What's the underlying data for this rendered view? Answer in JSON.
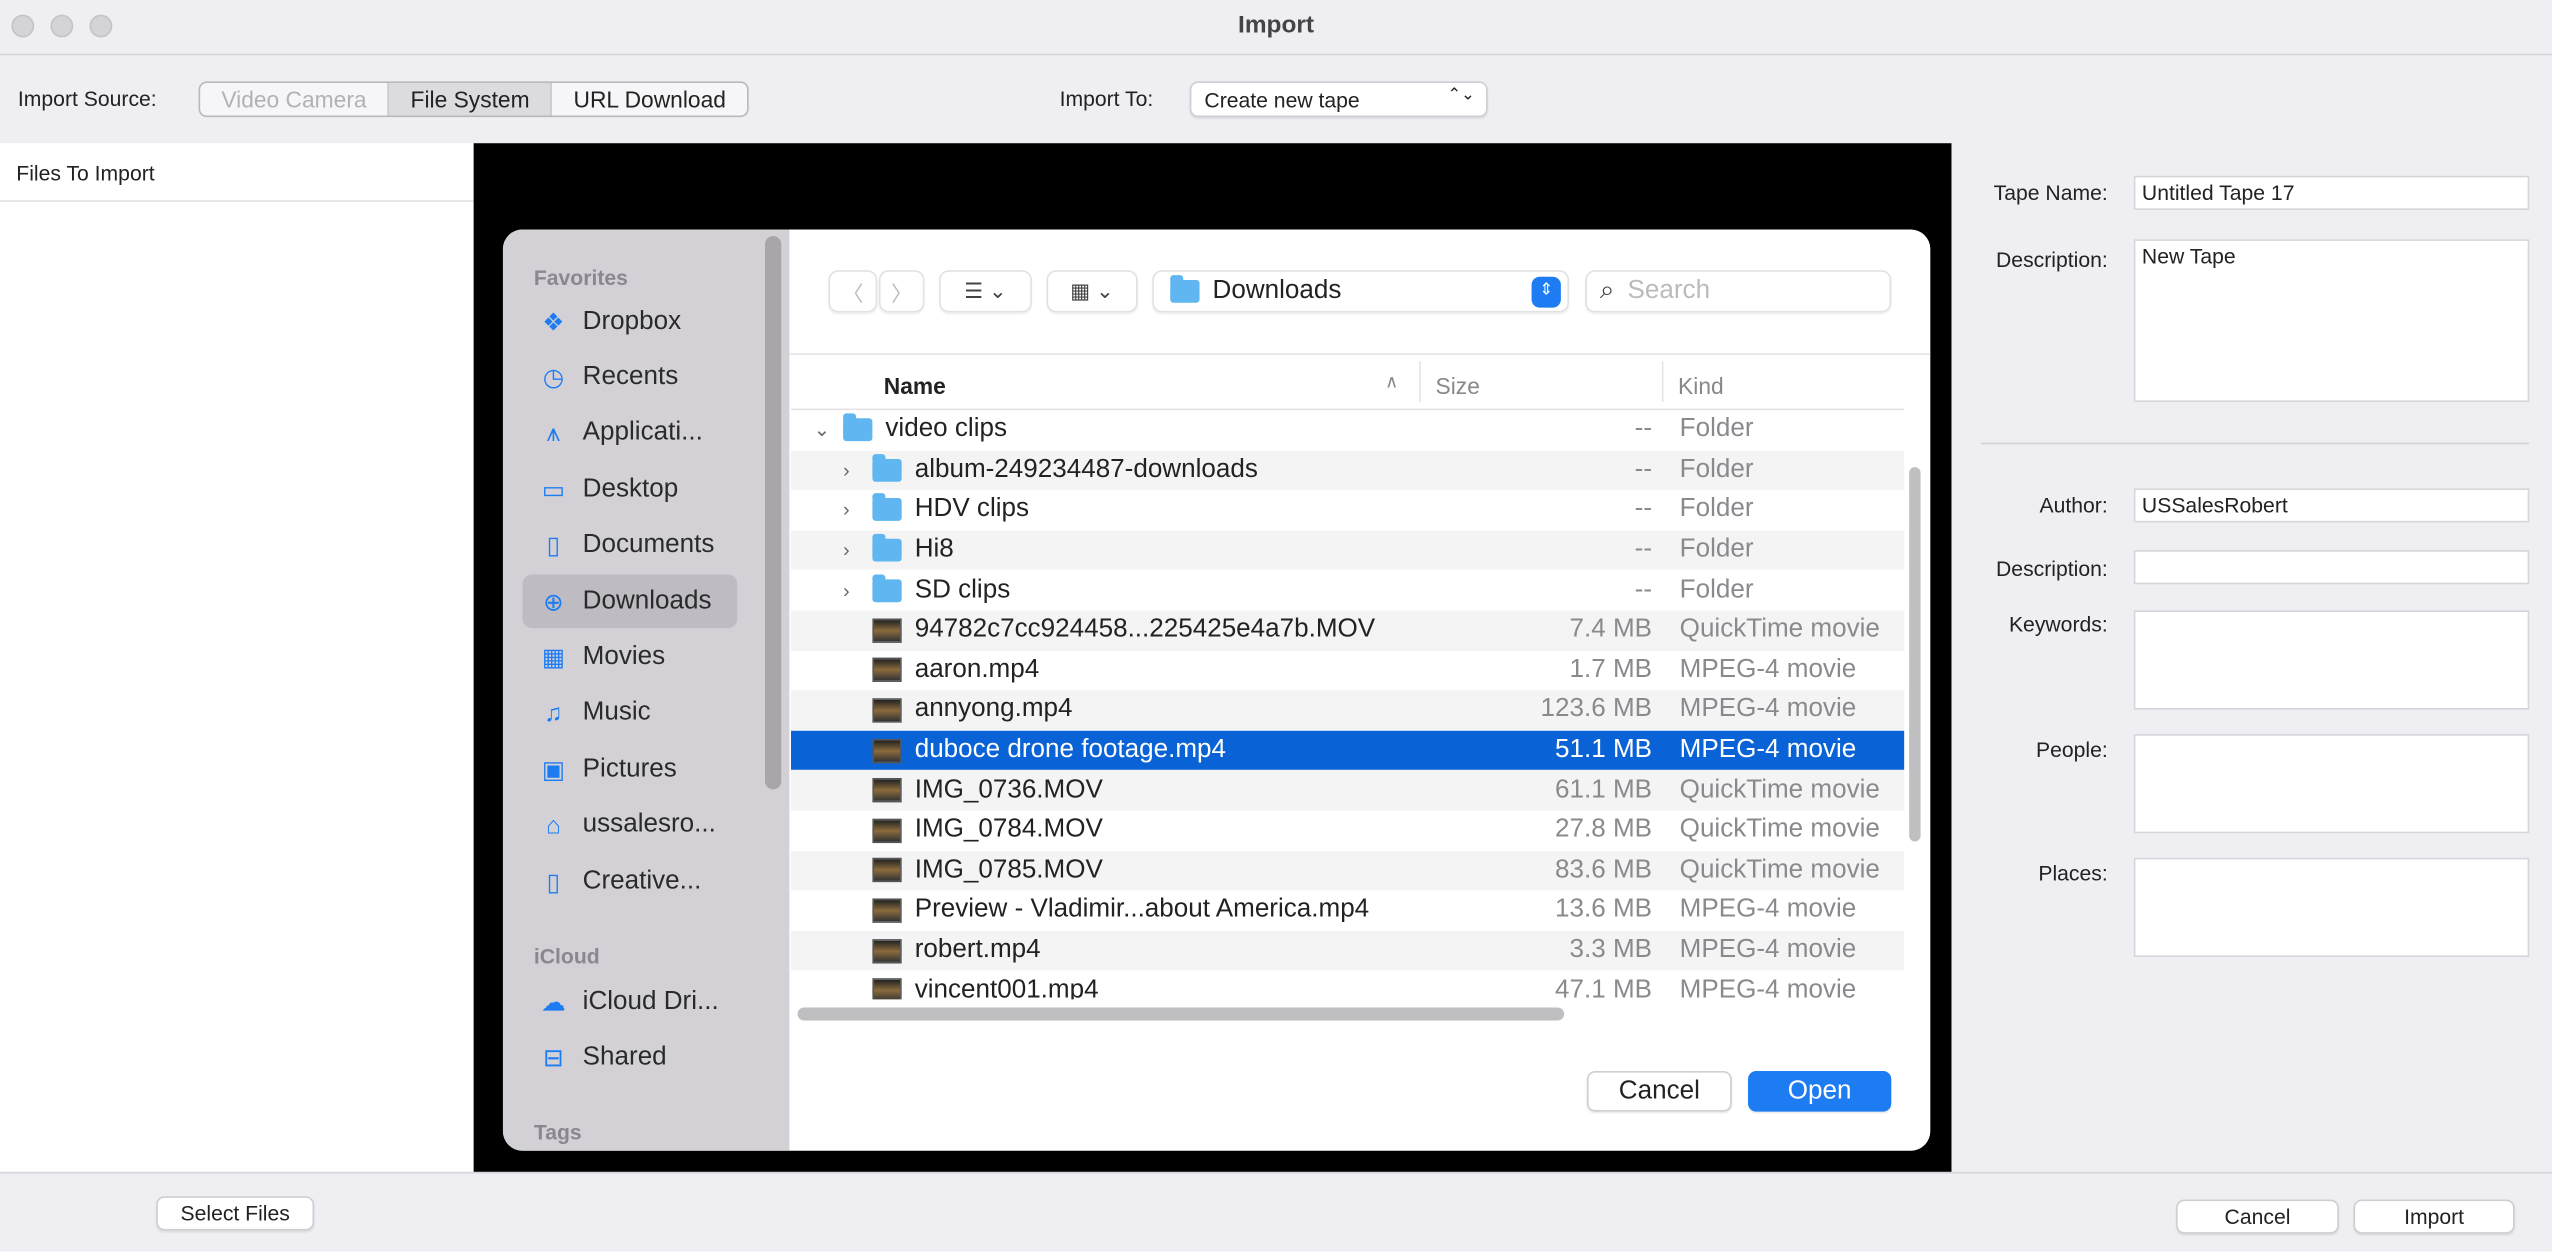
{
  "window": {
    "title": "Import"
  },
  "toolbar": {
    "source_label": "Import Source:",
    "sources": [
      "Video Camera",
      "File System",
      "URL Download"
    ],
    "selected_source": "File System",
    "import_to_label": "Import To:",
    "import_to_value": "Create new tape"
  },
  "left": {
    "header": "Files To Import",
    "select_files": "Select Files"
  },
  "dialog": {
    "sidebar": {
      "favorites_label": "Favorites",
      "favorites": [
        {
          "label": "Dropbox",
          "icon": "dropbox-icon",
          "glyph": "❖"
        },
        {
          "label": "Recents",
          "icon": "clock-icon",
          "glyph": "◷"
        },
        {
          "label": "Applicati...",
          "icon": "applications-icon",
          "glyph": "⩚"
        },
        {
          "label": "Desktop",
          "icon": "desktop-icon",
          "glyph": "▭"
        },
        {
          "label": "Documents",
          "icon": "document-icon",
          "glyph": "▯"
        },
        {
          "label": "Downloads",
          "icon": "downloads-icon",
          "glyph": "⊕"
        },
        {
          "label": "Movies",
          "icon": "film-icon",
          "glyph": "▦"
        },
        {
          "label": "Music",
          "icon": "music-icon",
          "glyph": "♫"
        },
        {
          "label": "Pictures",
          "icon": "pictures-icon",
          "glyph": "▣"
        },
        {
          "label": "ussalesro...",
          "icon": "home-icon",
          "glyph": "⌂"
        },
        {
          "label": "Creative...",
          "icon": "document-icon",
          "glyph": "▯"
        }
      ],
      "selected": "Downloads",
      "icloud_label": "iCloud",
      "icloud": [
        {
          "label": "iCloud Dri...",
          "icon": "cloud-icon",
          "glyph": "☁"
        },
        {
          "label": "Shared",
          "icon": "shared-folder-icon",
          "glyph": "⊟"
        }
      ],
      "tags_label": "Tags"
    },
    "location": "Downloads",
    "search_placeholder": "Search",
    "columns": {
      "name": "Name",
      "size": "Size",
      "kind": "Kind"
    },
    "files": [
      {
        "name": "video clips",
        "size": "--",
        "kind": "Folder",
        "type": "folder",
        "level": 0,
        "expanded": true
      },
      {
        "name": "album-249234487-downloads",
        "size": "--",
        "kind": "Folder",
        "type": "folder",
        "level": 1
      },
      {
        "name": "HDV clips",
        "size": "--",
        "kind": "Folder",
        "type": "folder",
        "level": 1
      },
      {
        "name": "Hi8",
        "size": "--",
        "kind": "Folder",
        "type": "folder",
        "level": 1
      },
      {
        "name": "SD clips",
        "size": "--",
        "kind": "Folder",
        "type": "folder",
        "level": 1
      },
      {
        "name": "94782c7cc924458...225425e4a7b.MOV",
        "size": "7.4 MB",
        "kind": "QuickTime movie",
        "type": "file",
        "level": 1
      },
      {
        "name": "aaron.mp4",
        "size": "1.7 MB",
        "kind": "MPEG-4 movie",
        "type": "file",
        "level": 1
      },
      {
        "name": "annyong.mp4",
        "size": "123.6 MB",
        "kind": "MPEG-4 movie",
        "type": "file",
        "level": 1
      },
      {
        "name": "duboce drone footage.mp4",
        "size": "51.1 MB",
        "kind": "MPEG-4 movie",
        "type": "file",
        "level": 1,
        "selected": true
      },
      {
        "name": "IMG_0736.MOV",
        "size": "61.1 MB",
        "kind": "QuickTime movie",
        "type": "file",
        "level": 1
      },
      {
        "name": "IMG_0784.MOV",
        "size": "27.8 MB",
        "kind": "QuickTime movie",
        "type": "file",
        "level": 1
      },
      {
        "name": "IMG_0785.MOV",
        "size": "83.6 MB",
        "kind": "QuickTime movie",
        "type": "file",
        "level": 1
      },
      {
        "name": "Preview - Vladimir...about America.mp4",
        "size": "13.6 MB",
        "kind": "MPEG-4 movie",
        "type": "file",
        "level": 1
      },
      {
        "name": "robert.mp4",
        "size": "3.3 MB",
        "kind": "MPEG-4 movie",
        "type": "file",
        "level": 1
      },
      {
        "name": "vincent001.mp4",
        "size": "47.1 MB",
        "kind": "MPEG-4 movie",
        "type": "file",
        "level": 1
      }
    ],
    "cancel": "Cancel",
    "open": "Open"
  },
  "right": {
    "tape_name_label": "Tape Name:",
    "tape_name": "Untitled Tape 17",
    "description_label": "Description:",
    "description": "New Tape",
    "author_label": "Author:",
    "author": "USSalesRobert",
    "meta_description_label": "Description:",
    "meta_description": "",
    "keywords_label": "Keywords:",
    "people_label": "People:",
    "places_label": "Places:"
  },
  "footer": {
    "cancel": "Cancel",
    "import": "Import"
  },
  "colors": {
    "accent": "#0a63d6",
    "sidebar": "#d3d1d6"
  }
}
